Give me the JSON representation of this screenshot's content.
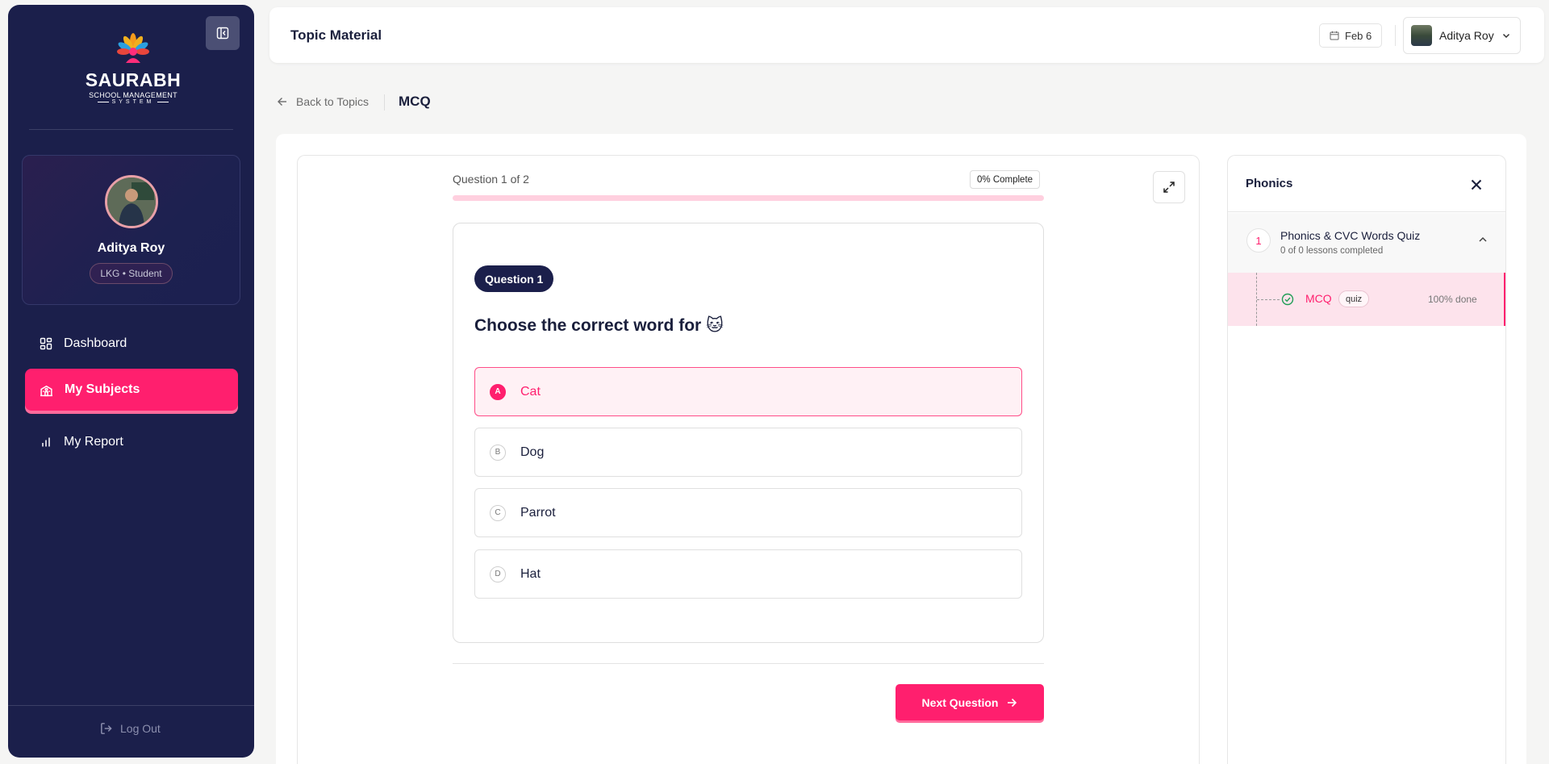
{
  "brand": {
    "name": "SAURABH",
    "subtitle": "SCHOOL MANAGEMENT",
    "tagline": "SYSTEM"
  },
  "profile": {
    "name": "Aditya Roy",
    "role": "LKG • Student"
  },
  "nav": {
    "items": [
      {
        "label": "Dashboard",
        "icon": "dashboard-icon",
        "active": false
      },
      {
        "label": "My Subjects",
        "icon": "school-icon",
        "active": true
      },
      {
        "label": "My Report",
        "icon": "bar-chart-icon",
        "active": false
      }
    ],
    "logout_label": "Log Out"
  },
  "header": {
    "title": "Topic Material",
    "date": "Feb 6",
    "user_name": "Aditya Roy"
  },
  "breadcrumb": {
    "back_label": "Back to Topics",
    "current": "MCQ"
  },
  "quiz": {
    "progress_label": "Question 1 of 2",
    "percent_label": "0% Complete",
    "progress_fraction": 0,
    "question_badge": "Question 1",
    "question_text": "Choose the correct word for 🐱",
    "options": [
      {
        "letter": "A",
        "text": "Cat",
        "selected": true
      },
      {
        "letter": "B",
        "text": "Dog",
        "selected": false
      },
      {
        "letter": "C",
        "text": "Parrot",
        "selected": false
      },
      {
        "letter": "D",
        "text": "Hat",
        "selected": false
      }
    ],
    "next_label": "Next Question"
  },
  "side_panel": {
    "title": "Phonics",
    "module": {
      "number": "1",
      "title": "Phonics & CVC Words Quiz",
      "subtitle": "0 of 0 lessons completed"
    },
    "lesson": {
      "name": "MCQ",
      "tag": "quiz",
      "status": "100% done"
    }
  },
  "colors": {
    "accent": "#ff1f6e",
    "sidebar_bg": "#1b1f4b",
    "progress_track": "#ffd0df"
  }
}
